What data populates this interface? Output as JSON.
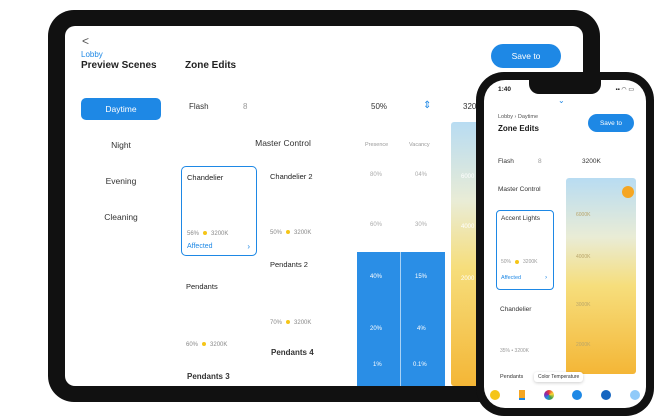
{
  "tablet": {
    "back_glyph": "<",
    "breadcrumb": "Lobby",
    "scenes_title": "Preview Scenes",
    "zone_title": "Zone Edits",
    "save_label": "Save to",
    "scenes": [
      "Daytime",
      "Night",
      "Evening",
      "Cleaning"
    ],
    "active_scene": "Daytime",
    "flash_label": "Flash",
    "flash_value": "8",
    "percent": "50%",
    "temp_clipped": "320",
    "master_control": "Master Control",
    "columns": [
      "Presence",
      "Vacancy"
    ],
    "level_rows": [
      [
        "80%",
        "04%"
      ],
      [
        "60%",
        "30%"
      ],
      [
        "40%",
        "15%"
      ],
      [
        "20%",
        "4%"
      ],
      [
        "1%",
        "0.1%"
      ]
    ],
    "temp_labels": [
      "6000",
      "4000",
      "2000"
    ],
    "cards": [
      {
        "name": "Chandelier",
        "level": "56%",
        "temp": "3200K",
        "affected": "Affected"
      },
      {
        "name": "Chandelier 2",
        "level": "50%",
        "temp": "3200K"
      },
      {
        "name": "Pendants",
        "level": "60%",
        "temp": "3200K"
      },
      {
        "name": "Pendants 2",
        "level": "70%",
        "temp": "3200K"
      }
    ],
    "extra_labels": [
      "Pendants 4",
      "Pendants 3"
    ]
  },
  "phone": {
    "time": "1:40",
    "breadcrumb": "Lobby  ›  Daytime",
    "title": "Zone Edits",
    "save_label": "Save to",
    "flash_label": "Flash",
    "flash_value": "8",
    "temp_value": "3200K",
    "master_control": "Master Control",
    "card": {
      "name": "Accent Lights",
      "level": "50%",
      "temp": "3200K",
      "affected": "Affected"
    },
    "chandelier": "Chandelier",
    "chandelier_stats": "35%  •  3200K",
    "pendants": "Pendants",
    "temp_scale": [
      "6000K",
      "4000K",
      "3000K",
      "2000K"
    ],
    "tooltip": "Color Temperature"
  },
  "colors": {
    "accent": "#1e88e5",
    "warm": "#f4b636",
    "cool": "#b8dcf2"
  }
}
